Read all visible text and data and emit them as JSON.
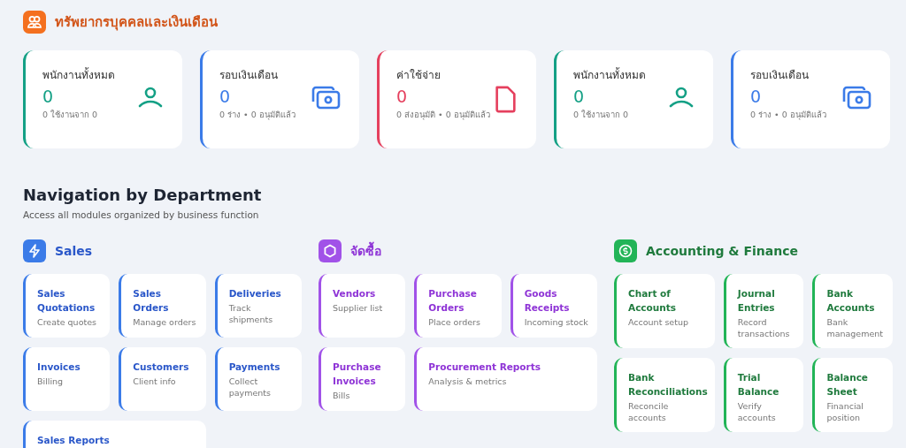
{
  "header": {
    "title": "ทรัพยากรบุคคลและเงินเดือน"
  },
  "stats": [
    {
      "label": "พนักงานทั้งหมด",
      "value": "0",
      "detail": "0 ใช้งานจาก 0",
      "kind": "person",
      "color": "#14a085"
    },
    {
      "label": "รอบเงินเดือน",
      "value": "0",
      "detail": "0 ร่าง • 0 อนุมัติแล้ว",
      "kind": "cash",
      "color": "#3b7be8"
    },
    {
      "label": "ค่าใช้จ่าย",
      "value": "0",
      "detail": "0 ส่งอนุมัติ • 0 อนุมัติแล้ว",
      "kind": "file",
      "color": "#e5405e"
    },
    {
      "label": "พนักงานทั้งหมด",
      "value": "0",
      "detail": "0 ใช้งานจาก 0",
      "kind": "person",
      "color": "#14a085"
    },
    {
      "label": "รอบเงินเดือน",
      "value": "0",
      "detail": "0 ร่าง • 0 อนุมัติแล้ว",
      "kind": "cash",
      "color": "#3b7be8"
    }
  ],
  "navigation": {
    "title": "Navigation by Department",
    "subtitle": "Access all modules organized by business function"
  },
  "departments": [
    {
      "name": "Sales",
      "kind": "bolt",
      "color": "#3b7be8",
      "modules": [
        {
          "title": "Sales Quotations",
          "desc": "Create quotes"
        },
        {
          "title": "Sales Orders",
          "desc": "Manage orders"
        },
        {
          "title": "Deliveries",
          "desc": "Track shipments"
        },
        {
          "title": "Invoices",
          "desc": "Billing"
        },
        {
          "title": "Customers",
          "desc": "Client info"
        },
        {
          "title": "Payments",
          "desc": "Collect payments"
        },
        {
          "title": "Sales Reports",
          "wide": true
        }
      ]
    },
    {
      "name": "จัดซื้อ",
      "kind": "hexagon",
      "color": "#a152e8",
      "modules": [
        {
          "title": "Vendors",
          "desc": "Supplier list"
        },
        {
          "title": "Purchase Orders",
          "desc": "Place orders"
        },
        {
          "title": "Goods Receipts",
          "desc": "Incoming stock"
        },
        {
          "title": "Purchase Invoices",
          "desc": "Bills"
        },
        {
          "title": "Procurement Reports",
          "desc": "Analysis & metrics",
          "wide": true
        }
      ]
    },
    {
      "name": "Accounting & Finance",
      "kind": "dollar",
      "color": "#22b457",
      "modules": [
        {
          "title": "Chart of Accounts",
          "desc": "Account setup"
        },
        {
          "title": "Journal Entries",
          "desc": "Record transactions"
        },
        {
          "title": "Bank Accounts",
          "desc": "Bank management"
        },
        {
          "title": "Bank Reconciliations",
          "desc": "Reconcile accounts"
        },
        {
          "title": "Trial Balance",
          "desc": "Verify accounts"
        },
        {
          "title": "Balance Sheet",
          "desc": "Financial position"
        }
      ]
    }
  ]
}
